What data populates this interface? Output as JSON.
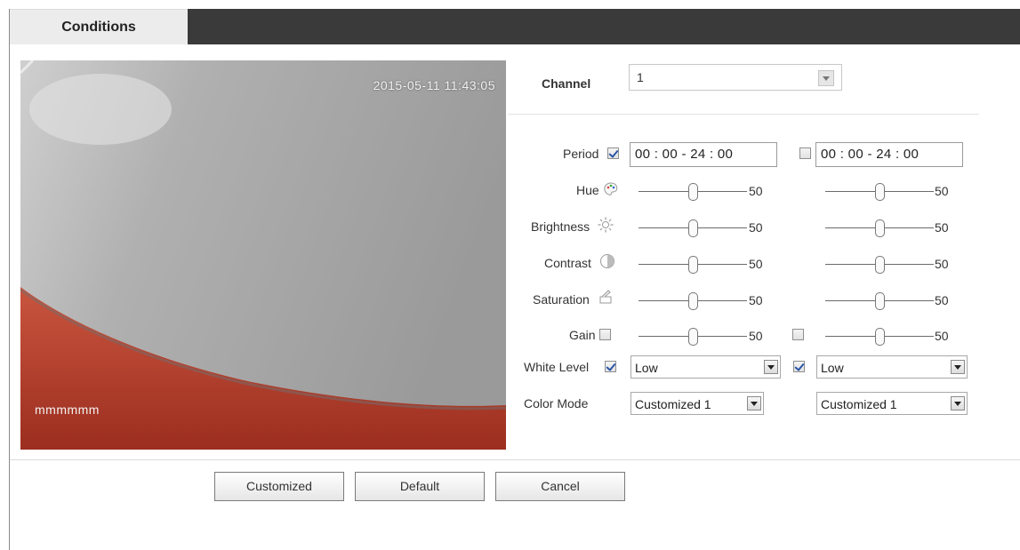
{
  "tab": {
    "label": "Conditions"
  },
  "video": {
    "timestamp": "2015-05-11 11:43:05",
    "channel_label": "mmmmmm"
  },
  "channel": {
    "label": "Channel",
    "value": "1"
  },
  "labels": {
    "period": "Period",
    "hue": "Hue",
    "brightness": "Brightness",
    "contrast": "Contrast",
    "saturation": "Saturation",
    "gain": "Gain",
    "white_level": "White Level",
    "color_mode": "Color Mode"
  },
  "col1": {
    "period_enabled": true,
    "period": "00 : 00  -  24 : 00",
    "hue": "50",
    "brightness": "50",
    "contrast": "50",
    "saturation": "50",
    "gain_enabled": false,
    "gain": "50",
    "white_level_enabled": true,
    "white_level": "Low",
    "color_mode": "Customized 1"
  },
  "col2": {
    "period_enabled": false,
    "period": "00 : 00  -  24 : 00",
    "hue": "50",
    "brightness": "50",
    "contrast": "50",
    "saturation": "50",
    "gain_enabled": false,
    "gain": "50",
    "white_level_enabled": true,
    "white_level": "Low",
    "color_mode": "Customized 1"
  },
  "buttons": {
    "customized": "Customized",
    "default": "Default",
    "cancel": "Cancel"
  },
  "icons": {
    "hue": "palette-icon",
    "brightness": "sun-icon",
    "contrast": "contrast-icon",
    "saturation": "saturation-icon",
    "select_arrow": "chevron-down-icon"
  },
  "colors": {
    "tab_bar": "#3a3a3a",
    "video_red": "#b7402c",
    "video_gray": "#a9a9a9"
  }
}
